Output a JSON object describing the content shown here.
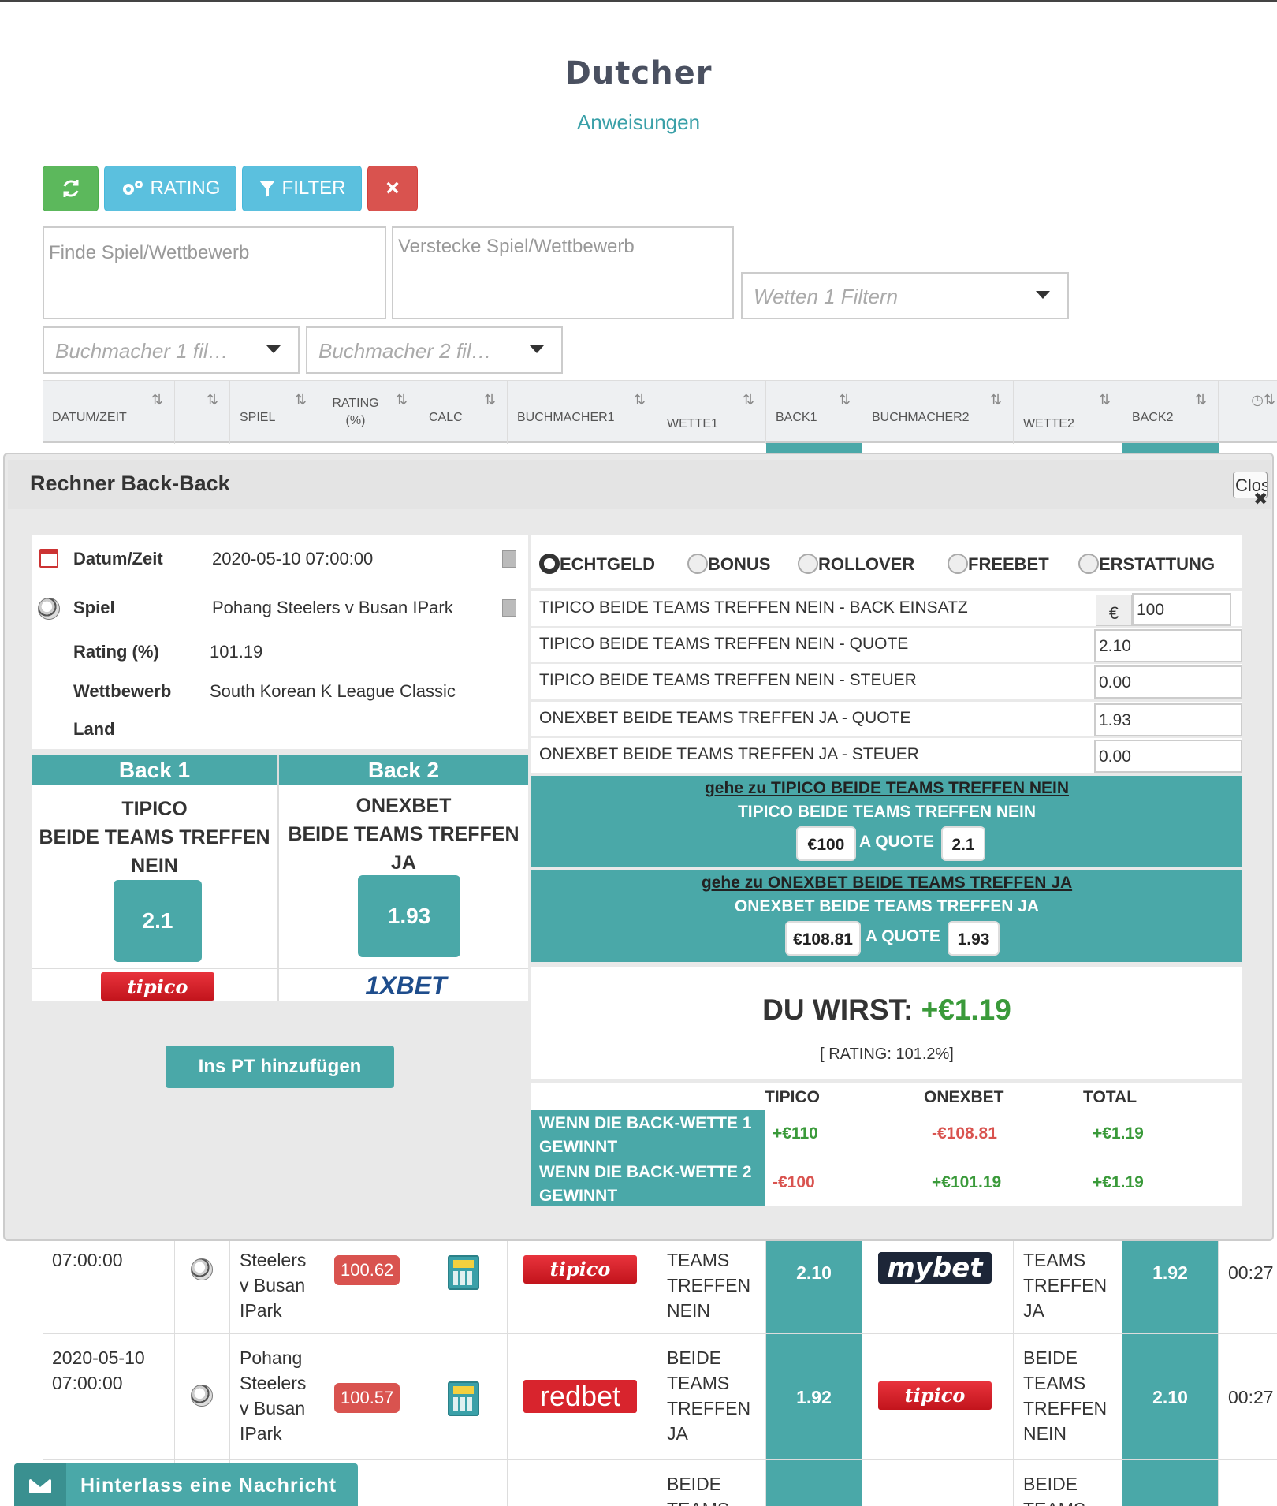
{
  "page": {
    "title": "Dutcher",
    "instructions_link": "Anweisungen"
  },
  "toolbar": {
    "refresh_icon": "refresh-icon",
    "rating_label": "RATING",
    "filter_label": "FILTER",
    "close_label": "×"
  },
  "filters": {
    "find_placeholder": "Finde Spiel/Wettbewerb",
    "hide_placeholder": "Verstecke Spiel/Wettbewerb",
    "bets1_placeholder": "Wetten 1 Filtern",
    "bookmaker1_placeholder": "Buchmacher 1 fil…",
    "bookmaker2_placeholder": "Buchmacher 2 fil…"
  },
  "table": {
    "headers": [
      "DATUM/ZEIT",
      "",
      "SPIEL",
      "RATING (%)",
      "CALC",
      "BUCHMACHER1",
      "WETTE1",
      "BACK1",
      "BUCHMACHER2",
      "WETTE2",
      "BACK2",
      ""
    ],
    "rows": [
      {
        "datetime": "07:00:00",
        "game": "Steelers v Busan IPark",
        "rating": "100.62",
        "bookmaker1": "tipico",
        "bet1": "TEAMS TREFFEN NEIN",
        "back1": "2.10",
        "bookmaker2": "mybet",
        "bet2": "TEAMS TREFFEN JA",
        "back2": "1.92",
        "time": "00:27"
      },
      {
        "datetime": "2020-05-10 07:00:00",
        "game": "Pohang Steelers v Busan IPark",
        "rating": "100.57",
        "bookmaker1": "redbet",
        "bet1": "BEIDE TEAMS TREFFEN JA",
        "back1": "1.92",
        "bookmaker2": "tipico",
        "bet2": "BEIDE TEAMS TREFFEN NEIN",
        "back2": "2.10",
        "time": "00:27"
      },
      {
        "bet1": "BEIDE TEAMS",
        "bet2": "BEIDE TEAMS"
      }
    ]
  },
  "modal": {
    "title": "Rechner Back-Back",
    "close_label": "Close",
    "info": {
      "datetime_label": "Datum/Zeit",
      "datetime": "2020-05-10 07:00:00",
      "game_label": "Spiel",
      "game": "Pohang Steelers v Busan IPark",
      "rating_label": "Rating (%)",
      "rating": "101.19",
      "competition_label": "Wettbewerb",
      "competition": "South Korean K League Classic",
      "country_label": "Land",
      "country": ""
    },
    "back1": {
      "header": "Back 1",
      "bookmaker": "TIPICO",
      "bet_line1": "BEIDE TEAMS TREFFEN",
      "bet_line2": "NEIN",
      "odds": "2.1",
      "logo": "tipico"
    },
    "back2": {
      "header": "Back 2",
      "bookmaker": "ONEXBET",
      "bet_line1": "BEIDE TEAMS TREFFEN",
      "bet_line2": "JA",
      "odds": "1.93",
      "logo": "1XBET"
    },
    "add_pt_button": "Ins PT hinzufügen",
    "modes": [
      "ECHTGELD",
      "BONUS",
      "ROLLOVER",
      "FREEBET",
      "ERSTATTUNG"
    ],
    "selected_mode": "ECHTGELD",
    "fields": [
      {
        "label": "TIPICO BEIDE TEAMS TREFFEN NEIN - BACK EINSATZ",
        "value": "100",
        "prefix": "€"
      },
      {
        "label": "TIPICO BEIDE TEAMS TREFFEN NEIN - QUOTE",
        "value": "2.10"
      },
      {
        "label": "TIPICO BEIDE TEAMS TREFFEN NEIN - STEUER",
        "value": "0.00"
      },
      {
        "label": "ONEXBET BEIDE TEAMS TREFFEN JA  - QUOTE",
        "value": "1.93"
      },
      {
        "label": "ONEXBET BEIDE TEAMS TREFFEN JA - STEUER",
        "value": "0.00"
      }
    ],
    "instructions": [
      {
        "link": "gehe zu TIPICO BEIDE TEAMS TREFFEN NEIN",
        "desc": "TIPICO BEIDE TEAMS TREFFEN NEIN",
        "stake": "€100",
        "at_quote": "A QUOTE",
        "quote": "2.1"
      },
      {
        "link": "gehe zu ONEXBET BEIDE TEAMS TREFFEN JA",
        "desc": "ONEXBET BEIDE TEAMS TREFFEN JA",
        "stake": "€108.81",
        "at_quote": "A QUOTE",
        "quote": "1.93"
      }
    ],
    "result": {
      "label": "DU WIRST:",
      "value": "+€1.19",
      "rating_note": "[ RATING: 101.2%]"
    },
    "profit_table": {
      "headers": [
        "TIPICO",
        "ONEXBET",
        "TOTAL"
      ],
      "rows": [
        {
          "label": "WENN DIE BACK-WETTE 1 GEWINNT",
          "tipico": "+€110",
          "onexbet": "-€108.81",
          "total": "+€1.19"
        },
        {
          "label": "WENN DIE BACK-WETTE 2 GEWINNT",
          "tipico": "-€100",
          "onexbet": "+€101.19",
          "total": "+€1.19"
        }
      ]
    }
  },
  "chat": {
    "label": "Hinterlass eine Nachricht"
  },
  "colors": {
    "teal": "#4aa8a8",
    "green": "#5cb85c",
    "blue": "#5bc0de",
    "red": "#d9534f",
    "profit_green": "#3a9a3a"
  }
}
